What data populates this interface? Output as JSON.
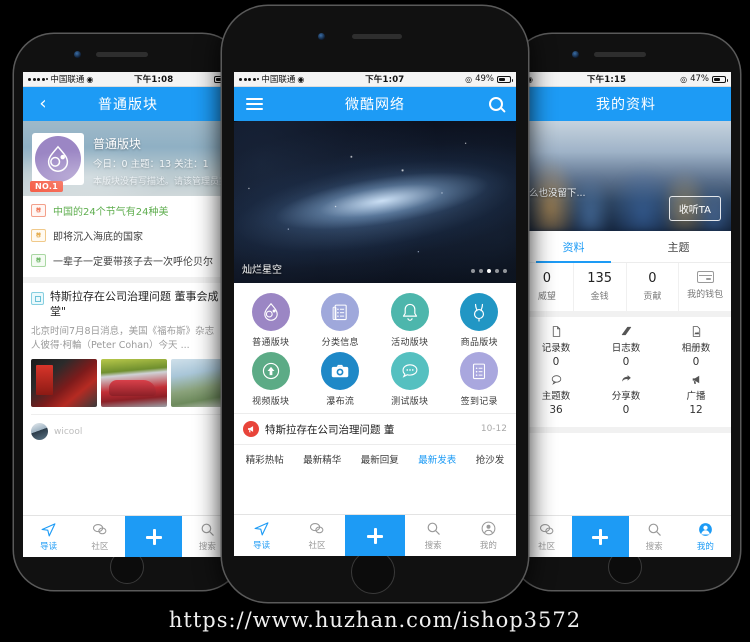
{
  "watermark": "https://www.huzhan.com/ishop3572",
  "left_phone": {
    "status": {
      "carrier": "中国联通",
      "time": "下午1:08",
      "battery": "",
      "wifi": "wifi-icon"
    },
    "appbar": {
      "back": "‹",
      "title": "普通版块"
    },
    "hero": {
      "badge": "NO.1",
      "title": "普通版块",
      "meta": "今日：0 主题：13 关注：1",
      "desc": "本版块没有写描述。请该管理员完"
    },
    "list": [
      {
        "tag": "荐",
        "text": "中国的24个节气有24种美",
        "color": "o"
      },
      {
        "tag": "荐",
        "text": "即将沉入海底的国家",
        "color": "y"
      },
      {
        "tag": "荐",
        "text": "一辈子一定要带孩子去一次呼伦贝尔",
        "color": "g"
      }
    ],
    "article": {
      "title": "特斯拉存在公司治理问题 董事会成员或\n堂\"",
      "title_line1": "特斯拉存在公司治理问题 董事会成",
      "title_line2": "堂\"",
      "body_line1": "北京时间7月8日消息，美国《福布斯》杂志",
      "body_line2": "人彼得·柯輪（Peter Cohan）今天 ...",
      "author": "wicool"
    },
    "tabbar": [
      {
        "label": "导读",
        "icon": "paper-plane-icon",
        "active": true
      },
      {
        "label": "社区",
        "icon": "chat-bubbles-icon",
        "active": false
      },
      {
        "label": "",
        "icon": "plus-icon",
        "active": false
      },
      {
        "label": "搜索",
        "icon": "search-icon",
        "active": false
      }
    ]
  },
  "mid_phone": {
    "status": {
      "carrier": "中国联通",
      "time": "下午1:07",
      "battery": "49%",
      "wifi": "wifi-icon"
    },
    "appbar": {
      "menu": "hamburger-icon",
      "title": "微酷网络",
      "search": "search-icon"
    },
    "banner": {
      "caption": "灿烂星空",
      "dot_count": 5,
      "active_dot": 3
    },
    "grid": [
      {
        "label": "普通版块",
        "icon": "droplet-face-icon",
        "color": "#9b86c4"
      },
      {
        "label": "分类信息",
        "icon": "list-document-icon",
        "color": "#9fa8db"
      },
      {
        "label": "活动版块",
        "icon": "bell-icon",
        "color": "#4db6ac"
      },
      {
        "label": "商品版块",
        "icon": "balloon-icon",
        "color": "#2196c4"
      },
      {
        "label": "视频版块",
        "icon": "upload-arrow-icon",
        "color": "#5cab86"
      },
      {
        "label": "瀑布流",
        "icon": "camera-icon",
        "color": "#1e88c7"
      },
      {
        "label": "测试版块",
        "icon": "comment-dots-icon",
        "color": "#55c0c0"
      },
      {
        "label": "签到记录",
        "icon": "clipboard-icon",
        "color": "#a9a7de"
      }
    ],
    "post": {
      "badge": "megaphone-icon",
      "title": "特斯拉存在公司治理问题 董",
      "time": "10-12"
    },
    "subtabs": [
      {
        "label": "精彩热帖",
        "active": false
      },
      {
        "label": "最新精华",
        "active": false
      },
      {
        "label": "最新回复",
        "active": false
      },
      {
        "label": "最新发表",
        "active": true
      },
      {
        "label": "抢沙发",
        "active": false
      }
    ],
    "tabbar": [
      {
        "label": "导读",
        "icon": "paper-plane-icon",
        "active": true
      },
      {
        "label": "社区",
        "icon": "chat-bubbles-icon",
        "active": false
      },
      {
        "label": "",
        "icon": "plus-icon",
        "active": false
      },
      {
        "label": "搜索",
        "icon": "search-icon",
        "active": false
      },
      {
        "label": "我的",
        "icon": "person-icon",
        "active": false
      }
    ]
  },
  "right_phone": {
    "status": {
      "carrier": "",
      "time": "下午1:15",
      "battery": "47%",
      "wifi": "wifi-icon"
    },
    "appbar": {
      "title": "我的资料"
    },
    "cover": {
      "signature": "么也没留下...",
      "follow_label": "收听TA"
    },
    "tabs": [
      {
        "label": "资料",
        "active": true
      },
      {
        "label": "主题",
        "active": false
      }
    ],
    "stats": [
      {
        "value": "0",
        "label": "威望"
      },
      {
        "value": "135",
        "label": "金钱"
      },
      {
        "value": "0",
        "label": "贡献"
      },
      {
        "value": "",
        "label": "我的钱包",
        "icon": "wallet-icon"
      }
    ],
    "counts": [
      {
        "label": "记录数",
        "value": "0",
        "icon": "document-icon"
      },
      {
        "label": "日志数",
        "value": "0",
        "icon": "book-icon"
      },
      {
        "label": "相册数",
        "value": "0",
        "icon": "photo-icon"
      },
      {
        "label": "主题数",
        "value": "36",
        "icon": "comment-icon"
      },
      {
        "label": "分享数",
        "value": "0",
        "icon": "share-icon"
      },
      {
        "label": "广播",
        "value": "12",
        "icon": "megaphone-icon"
      }
    ],
    "tabbar": [
      {
        "label": "社区",
        "icon": "chat-bubbles-icon",
        "active": false
      },
      {
        "label": "",
        "icon": "plus-icon",
        "active": false
      },
      {
        "label": "搜索",
        "icon": "search-icon",
        "active": false
      },
      {
        "label": "我的",
        "icon": "person-icon",
        "active": true
      }
    ]
  },
  "colors": {
    "accent": "#1d9bf5",
    "badge_red": "#e8443a",
    "no1_red": "#f4543c"
  }
}
